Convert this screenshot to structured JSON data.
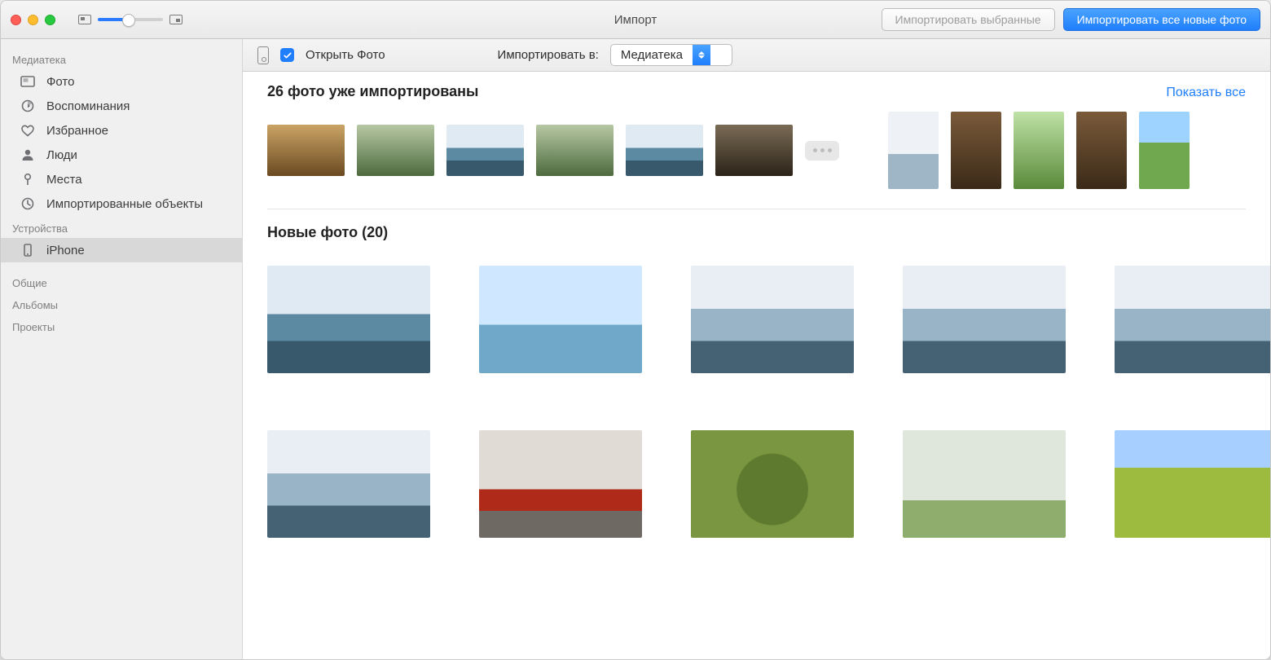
{
  "window": {
    "title": "Импорт"
  },
  "toolbar": {
    "import_selected": "Импортировать выбранные",
    "import_all_new": "Импортировать все новые фото"
  },
  "subbar": {
    "open_photos_label": "Открыть Фото",
    "open_photos_checked": true,
    "import_to_label": "Импортировать в:",
    "import_to_value": "Медиатека"
  },
  "sidebar": {
    "sections": {
      "library": "Медиатека",
      "devices": "Устройства",
      "shared": "Общие",
      "albums": "Альбомы",
      "projects": "Проекты"
    },
    "library_items": [
      {
        "id": "photos",
        "label": "Фото",
        "icon": "photos"
      },
      {
        "id": "memories",
        "label": "Воспоминания",
        "icon": "memories"
      },
      {
        "id": "fav",
        "label": "Избранное",
        "icon": "heart"
      },
      {
        "id": "people",
        "label": "Люди",
        "icon": "person"
      },
      {
        "id": "places",
        "label": "Места",
        "icon": "pin"
      },
      {
        "id": "imports",
        "label": "Импортированные объекты",
        "icon": "clock"
      }
    ],
    "device_items": [
      {
        "id": "iphone",
        "label": "iPhone",
        "icon": "device",
        "selected": true
      }
    ]
  },
  "imported": {
    "heading": "26 фото уже импортированы",
    "show_all": "Показать все",
    "thumbs_left": [
      "g-warm",
      "g-forest",
      "g-lake",
      "g-forest",
      "g-lake",
      "g-dark"
    ],
    "thumbs_right": [
      "g-snow",
      "g-wood",
      "g-green",
      "g-wood",
      "g-hill"
    ]
  },
  "new_photos": {
    "heading": "Новые фото (20)",
    "thumbs": [
      "g-lake",
      "g-sky",
      "g-port",
      "g-port",
      "g-port",
      "g-port",
      "g-red",
      "g-bush",
      "g-tree",
      "g-field"
    ]
  }
}
